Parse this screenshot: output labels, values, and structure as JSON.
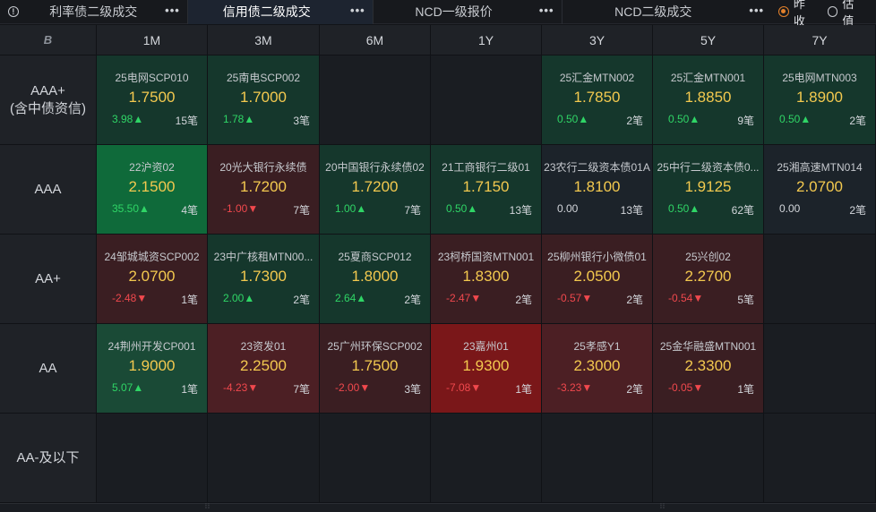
{
  "tabs": [
    {
      "label": "利率债二级成交",
      "more": "•••",
      "active": false
    },
    {
      "label": "信用债二级成交",
      "more": "•••",
      "active": true
    },
    {
      "label": "NCD一级报价",
      "more": "•••",
      "active": false
    },
    {
      "label": "NCD二级成交",
      "more": "•••",
      "active": false
    }
  ],
  "radios": [
    {
      "label": "昨收",
      "checked": true
    },
    {
      "label": "估值",
      "checked": false
    }
  ],
  "info_icon": "info-circle-icon",
  "logo_text": "B",
  "columns": [
    "1M",
    "3M",
    "6M",
    "1Y",
    "3Y",
    "5Y",
    "7Y"
  ],
  "rows": [
    {
      "label": "AAA+\n(含中债资信)",
      "cells": [
        {
          "name": "25电网SCP010",
          "rate": "1.7500",
          "chg": "3.98▲",
          "cnt": "15笔",
          "dir": "up",
          "tone": "green-dark"
        },
        {
          "name": "25南电SCP002",
          "rate": "1.7000",
          "chg": "1.78▲",
          "cnt": "3笔",
          "dir": "up",
          "tone": "green-dark"
        },
        null,
        null,
        {
          "name": "25汇金MTN002",
          "rate": "1.7850",
          "chg": "0.50▲",
          "cnt": "2笔",
          "dir": "up",
          "tone": "green-dark"
        },
        {
          "name": "25汇金MTN001",
          "rate": "1.8850",
          "chg": "0.50▲",
          "cnt": "9笔",
          "dir": "up",
          "tone": "green-dark"
        },
        {
          "name": "25电网MTN003",
          "rate": "1.8900",
          "chg": "0.50▲",
          "cnt": "2笔",
          "dir": "up",
          "tone": "green-dark"
        }
      ]
    },
    {
      "label": "AAA",
      "cells": [
        {
          "name": "22沪资02",
          "rate": "2.1500",
          "chg": "35.50▲",
          "cnt": "4笔",
          "dir": "up",
          "tone": "green-bright"
        },
        {
          "name": "20光大银行永续债",
          "rate": "1.7200",
          "chg": "-1.00▼",
          "cnt": "7笔",
          "dir": "down",
          "tone": "red-dark"
        },
        {
          "name": "20中国银行永续债02",
          "rate": "1.7200",
          "chg": "1.00▲",
          "cnt": "7笔",
          "dir": "up",
          "tone": "green-dark"
        },
        {
          "name": "21工商银行二级01",
          "rate": "1.7150",
          "chg": "0.50▲",
          "cnt": "13笔",
          "dir": "up",
          "tone": "green-dark"
        },
        {
          "name": "23农行二级资本债01A",
          "rate": "1.8100",
          "chg": "0.00",
          "cnt": "13笔",
          "dir": "flat",
          "tone": "neutral"
        },
        {
          "name": "25中行二级资本债0...",
          "rate": "1.9125",
          "chg": "0.50▲",
          "cnt": "62笔",
          "dir": "up",
          "tone": "green-dark"
        },
        {
          "name": "25湘高速MTN014",
          "rate": "2.0700",
          "chg": "0.00",
          "cnt": "2笔",
          "dir": "flat",
          "tone": "neutral"
        }
      ]
    },
    {
      "label": "AA+",
      "cells": [
        {
          "name": "24邹城城资SCP002",
          "rate": "2.0700",
          "chg": "-2.48▼",
          "cnt": "1笔",
          "dir": "down",
          "tone": "red-dark"
        },
        {
          "name": "23中广核租MTN00...",
          "rate": "1.7300",
          "chg": "2.00▲",
          "cnt": "2笔",
          "dir": "up",
          "tone": "green-dark"
        },
        {
          "name": "25夏商SCP012",
          "rate": "1.8000",
          "chg": "2.64▲",
          "cnt": "2笔",
          "dir": "up",
          "tone": "green-dark"
        },
        {
          "name": "23柯桥国资MTN001",
          "rate": "1.8300",
          "chg": "-2.47▼",
          "cnt": "2笔",
          "dir": "down",
          "tone": "red-dark"
        },
        {
          "name": "25柳州银行小微债01",
          "rate": "2.0500",
          "chg": "-0.57▼",
          "cnt": "2笔",
          "dir": "down",
          "tone": "red-dark"
        },
        {
          "name": "25兴创02",
          "rate": "2.2700",
          "chg": "-0.54▼",
          "cnt": "5笔",
          "dir": "down",
          "tone": "red-dark"
        },
        null
      ]
    },
    {
      "label": "AA",
      "cells": [
        {
          "name": "24荆州开发CP001",
          "rate": "1.9000",
          "chg": "5.07▲",
          "cnt": "1笔",
          "dir": "up",
          "tone": "green-mid"
        },
        {
          "name": "23资发01",
          "rate": "2.2500",
          "chg": "-4.23▼",
          "cnt": "7笔",
          "dir": "down",
          "tone": "red-mid"
        },
        {
          "name": "25广州环保SCP002",
          "rate": "1.7500",
          "chg": "-2.00▼",
          "cnt": "3笔",
          "dir": "down",
          "tone": "red-dark"
        },
        {
          "name": "23嘉州01",
          "rate": "1.9300",
          "chg": "-7.08▼",
          "cnt": "1笔",
          "dir": "down",
          "tone": "red-bright"
        },
        {
          "name": "25孝感Y1",
          "rate": "2.3000",
          "chg": "-3.23▼",
          "cnt": "2笔",
          "dir": "down",
          "tone": "red-mid"
        },
        {
          "name": "25金华融盛MTN001",
          "rate": "2.3300",
          "chg": "-0.05▼",
          "cnt": "1笔",
          "dir": "down",
          "tone": "red-dark"
        },
        null
      ]
    },
    {
      "label": "AA-及以下",
      "cells": [
        null,
        null,
        null,
        null,
        null,
        null,
        null
      ]
    }
  ],
  "colors": {
    "up": "#2fd566",
    "down": "#f0484d",
    "rate": "#f3c94f",
    "radio_accent": "#e3812b",
    "active_tab": "#1d2430"
  }
}
